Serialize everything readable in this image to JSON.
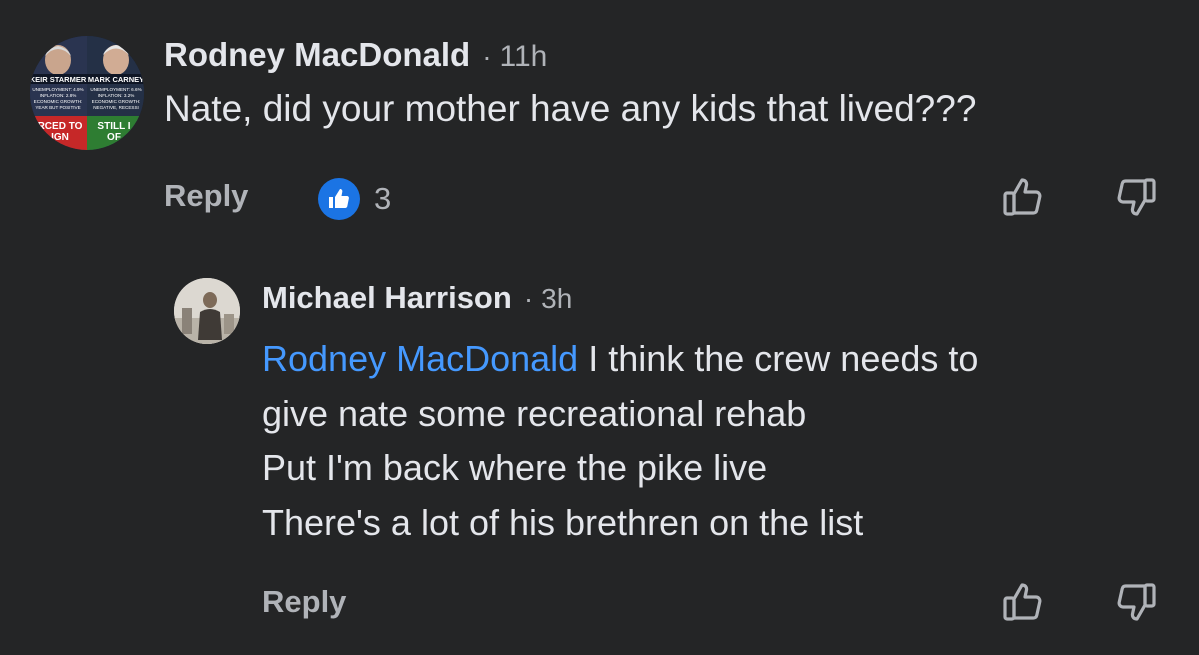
{
  "comment": {
    "author": "Rodney MacDonald",
    "separator": "·",
    "time": "11h",
    "text": "Nate, did your mother have any kids that lived???",
    "reply_label": "Reply",
    "reaction_count": "3",
    "avatar_text": {
      "left_name": "KEIR STARMER",
      "right_name": "MARK CARNEY",
      "left_stats": [
        "UNEMPLOYMENT: 4.9%",
        "INFLATION: 2.8%",
        "ECONOMIC GROWTH:",
        "YEAR BUT POSITIVE"
      ],
      "right_stats": [
        "UNEMPLOYMENT: 6.6%",
        "INFLATION: 3.2%",
        "ECONOMIC GROWTH:",
        "NEGATIVE, RECESSI"
      ],
      "left_banner": "RCED TO",
      "left_banner_2": "IGN",
      "right_banner": "STILL I",
      "right_banner_2": "OF"
    }
  },
  "reply": {
    "author": "Michael Harrison",
    "separator": "·",
    "time": "3h",
    "mention": "Rodney MacDonald",
    "lines": [
      " I think the crew needs to",
      "give nate some recreational rehab",
      "Put I'm back where the pike live",
      "There's a lot of his brethren on the list"
    ],
    "reply_label": "Reply"
  },
  "colors": {
    "background": "#242526",
    "primary_text": "#e4e6eb",
    "secondary_text": "#b0b3b8",
    "mention": "#4599ff",
    "like_badge": "#1b74e4"
  },
  "icons": {
    "like_badge": "thumbs-up-icon",
    "upvote": "thumbs-up-outline-icon",
    "downvote": "thumbs-down-outline-icon"
  }
}
